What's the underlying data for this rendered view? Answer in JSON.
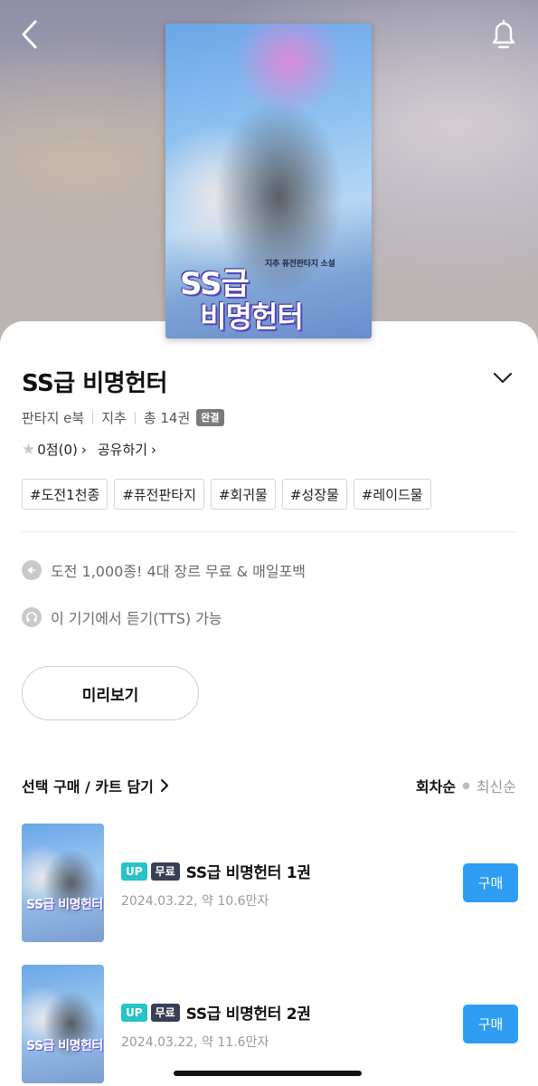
{
  "hero": {
    "cover_author_text": "지추 퓨전판타지 소설",
    "cover_title_line1": "SS급",
    "cover_title_line2": "비명헌터"
  },
  "book": {
    "title": "SS급 비명헌터",
    "genre": "판타지 e북",
    "author": "지추",
    "volumes": "총 14권",
    "status": "완결",
    "rating_text": "0점(0)",
    "share_label": "공유하기",
    "tags": [
      "#도전1천종",
      "#퓨전판타지",
      "#회귀물",
      "#성장물",
      "#레이드물"
    ]
  },
  "info": {
    "promo": "도전 1,000종! 4대 장르 무료 & 매일포백",
    "tts": "이 기기에서 듣기(TTS) 가능"
  },
  "actions": {
    "preview_label": "미리보기",
    "select_label": "선택 구매 / 카트 담기",
    "sort_active": "회차순",
    "sort_inactive": "최신순"
  },
  "episodes": [
    {
      "badge_up": "UP",
      "badge_free": "무료",
      "title": "SS급 비명헌터 1권",
      "meta": "2024.03.22, 약 10.6만자",
      "buy_label": "구매",
      "thumb_title": "SS급 비명헌터"
    },
    {
      "badge_up": "UP",
      "badge_free": "무료",
      "title": "SS급 비명헌터 2권",
      "meta": "2024.03.22, 약 11.6만자",
      "buy_label": "구매",
      "thumb_title": "SS급 비명헌터"
    }
  ],
  "colors": {
    "accent_blue": "#2f9df2",
    "badge_up": "#27c3c8",
    "badge_free": "#3a3f55",
    "status_badge": "#7a7a7a"
  },
  "icons": {
    "back": "back-chevron-icon",
    "bell": "bell-icon",
    "expand": "chevron-down-icon",
    "star": "star-icon",
    "promo": "megaphone-icon",
    "tts": "headphones-icon"
  }
}
